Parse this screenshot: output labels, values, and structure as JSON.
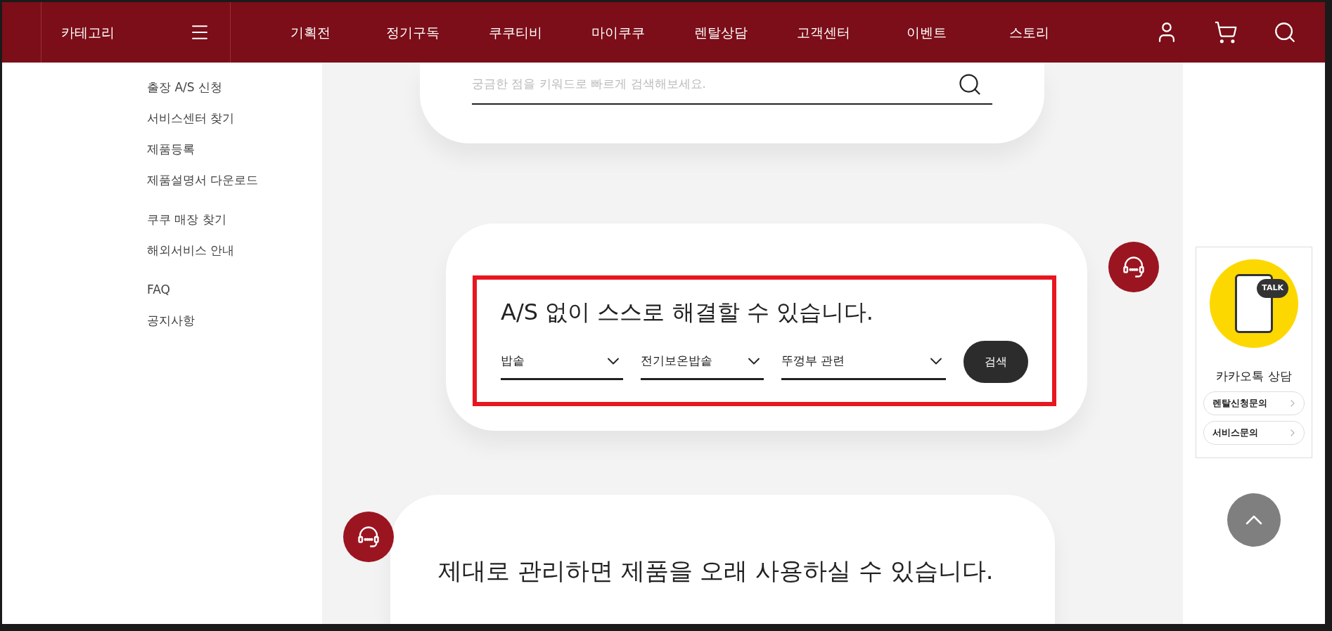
{
  "header": {
    "category_label": "카테고리",
    "nav": [
      "기획전",
      "정기구독",
      "쿠쿠티비",
      "마이쿠쿠",
      "렌탈상담",
      "고객센터",
      "이벤트",
      "스토리"
    ]
  },
  "sidebar": {
    "groups": [
      [
        "출장 A/S 신청",
        "서비스센터 찾기",
        "제품등록",
        "제품설명서 다운로드"
      ],
      [
        "쿠쿠 매장 찾기",
        "해외서비스 안내"
      ],
      [
        "FAQ",
        "공지사항"
      ]
    ]
  },
  "search_card": {
    "placeholder": "궁금한 점을 키워드로 빠르게 검색해보세요."
  },
  "solve_card": {
    "title": "A/S 없이 스스로 해결할 수 있습니다.",
    "selects": [
      {
        "value": "밥솥"
      },
      {
        "value": "전기보온밥솥"
      },
      {
        "value": "뚜껑부 관련"
      }
    ],
    "button": "검색"
  },
  "care_card": {
    "title": "제대로 관리하면 제품을 오래 사용하실 수 있습니다."
  },
  "kakao": {
    "icon_text": "TALK",
    "title": "카카오톡 상담",
    "links": [
      "렌탈신청문의",
      "서비스문의"
    ]
  }
}
